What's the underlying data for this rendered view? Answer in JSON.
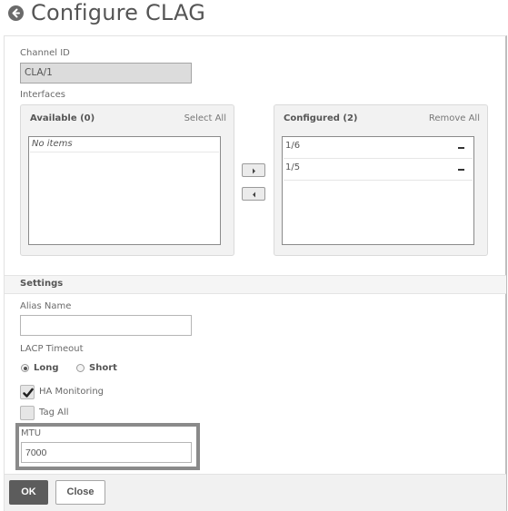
{
  "header": {
    "title": "Configure CLAG",
    "back_icon": "arrow-left-circle-icon"
  },
  "form": {
    "channel_id": {
      "label": "Channel ID",
      "value": "CLA/1",
      "disabled": true
    },
    "interfaces": {
      "label": "Interfaces",
      "available": {
        "title": "Available (0)",
        "action": "Select All",
        "items": [],
        "empty_text": "No items"
      },
      "configured": {
        "title": "Configured (2)",
        "action": "Remove All",
        "items": [
          {
            "label": "1/6",
            "remove_icon": "minus-icon"
          },
          {
            "label": "1/5",
            "remove_icon": "minus-icon"
          }
        ]
      },
      "move_right_icon": "triangle-right-icon",
      "move_left_icon": "triangle-left-icon"
    },
    "settings": {
      "section_title": "Settings",
      "alias_name": {
        "label": "Alias Name",
        "value": ""
      },
      "lacp_timeout": {
        "label": "LACP Timeout",
        "options": [
          "Long",
          "Short"
        ],
        "selected": "Long"
      },
      "ha_monitoring": {
        "label": "HA Monitoring",
        "checked": true
      },
      "tag_all": {
        "label": "Tag All",
        "checked": false
      },
      "mtu": {
        "label": "MTU",
        "value": "7000"
      }
    }
  },
  "footer": {
    "ok_label": "OK",
    "close_label": "Close"
  }
}
